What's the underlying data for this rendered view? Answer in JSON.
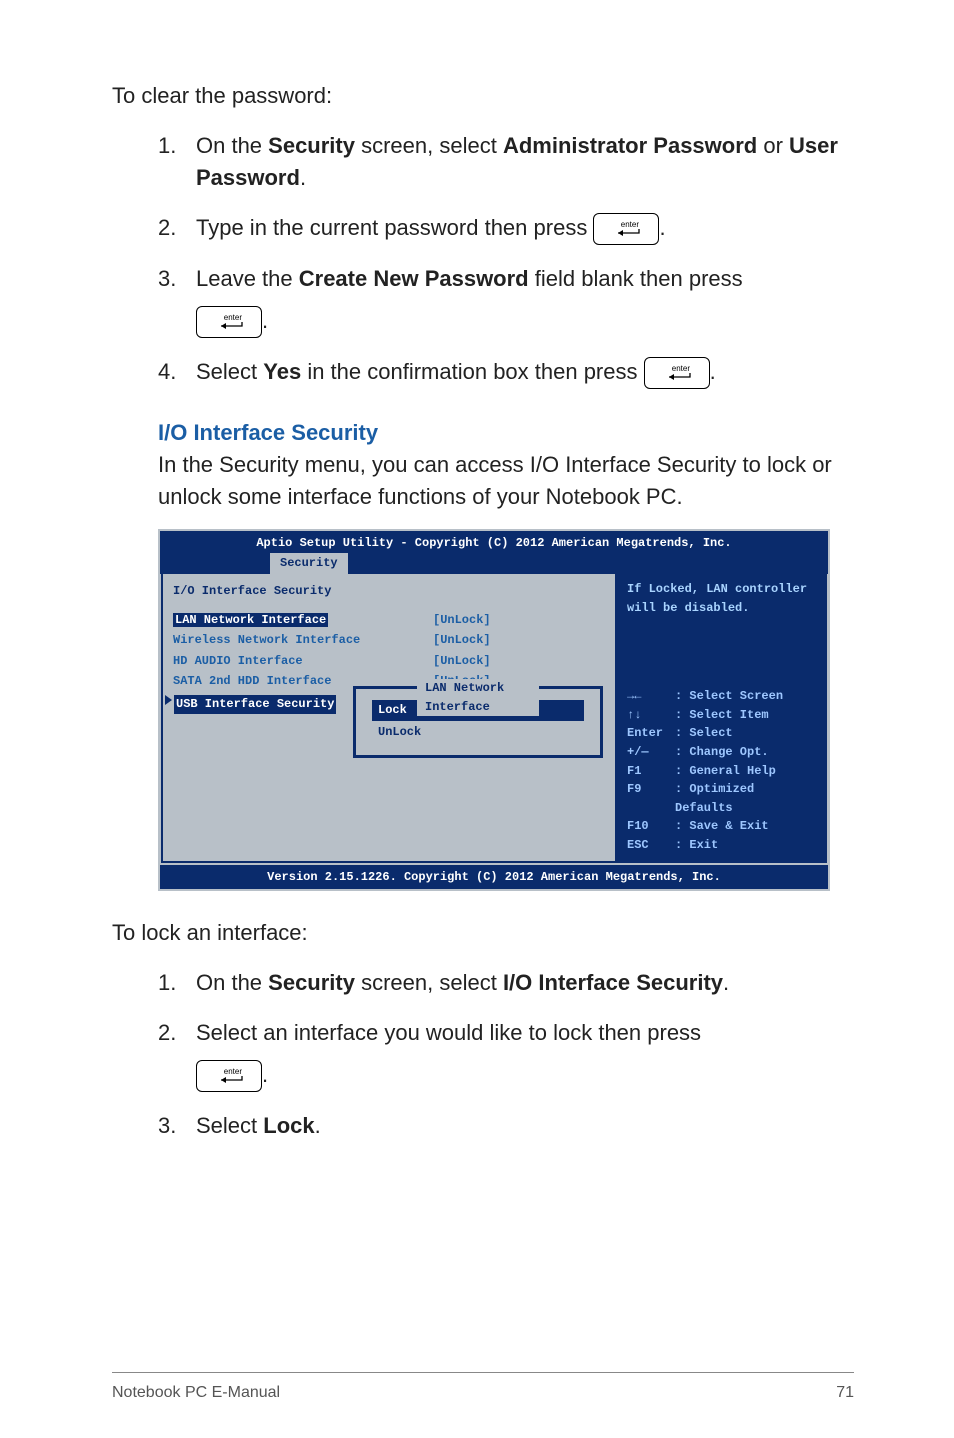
{
  "intro": "To clear the password:",
  "steps_a": [
    {
      "num": "1.",
      "pre": "On the ",
      "b1": "Security",
      "mid": " screen, select ",
      "b2": "Administrator Password",
      "tail": " or ",
      "b3": "User Password",
      "end": "."
    },
    {
      "num": "2.",
      "pre": "Type in the current password then press ",
      "key": true,
      "end": "."
    },
    {
      "num": "3.",
      "pre": "Leave the ",
      "b1": "Create New Password",
      "mid": " field blank then press ",
      "keybelow": true,
      "end": "."
    },
    {
      "num": "4.",
      "pre": "Select ",
      "b1": "Yes",
      "mid": " in the confirmation box then press ",
      "key": true,
      "end": "."
    }
  ],
  "section_heading": "I/O Interface Security",
  "section_desc": "In the Security menu, you can access I/O Interface Security to lock or unlock some interface functions of your Notebook PC.",
  "bios": {
    "header": "Aptio Setup Utility - Copyright (C) 2012 American Megatrends, Inc.",
    "tab": "Security",
    "panel_title": "I/O Interface Security",
    "rows": [
      {
        "label": "LAN Network Interface",
        "value": "[UnLock]",
        "selectedLabel": true
      },
      {
        "label": "Wireless Network Interface",
        "value": "[UnLock]"
      },
      {
        "label": "HD AUDIO Interface",
        "value": "[UnLock]"
      },
      {
        "label": "SATA 2nd HDD Interface",
        "value": "[UnLock]"
      }
    ],
    "usb_label": "USB Interface Security",
    "popup_title": "LAN Network Interface",
    "popup_options": [
      "Lock",
      "UnLock"
    ],
    "help_top": "If Locked, LAN controller will be disabled.",
    "help_keys": [
      {
        "k": "→←",
        "d": ": Select Screen"
      },
      {
        "k": "↑↓",
        "d": ": Select Item"
      },
      {
        "k": "Enter",
        "d": ": Select"
      },
      {
        "k": "+/—",
        "d": ": Change Opt."
      },
      {
        "k": "F1",
        "d": ": General Help"
      },
      {
        "k": "F9",
        "d": ": Optimized Defaults"
      },
      {
        "k": "F10",
        "d": ": Save & Exit"
      },
      {
        "k": "ESC",
        "d": ": Exit"
      }
    ],
    "footer": "Version 2.15.1226. Copyright (C) 2012 American Megatrends, Inc."
  },
  "lock_intro": "To lock an interface:",
  "steps_b": [
    {
      "num": "1.",
      "pre": "On the ",
      "b1": "Security",
      "mid": " screen, select ",
      "b2": "I/O Interface Security",
      "end": "."
    },
    {
      "num": "2.",
      "pre": "Select an interface you would like to lock then press ",
      "keybelow": true,
      "end": "."
    },
    {
      "num": "3.",
      "pre": "Select ",
      "b1": "Lock",
      "end": "."
    }
  ],
  "footer_left": "Notebook PC E-Manual",
  "footer_right": "71",
  "enter_label": "enter"
}
